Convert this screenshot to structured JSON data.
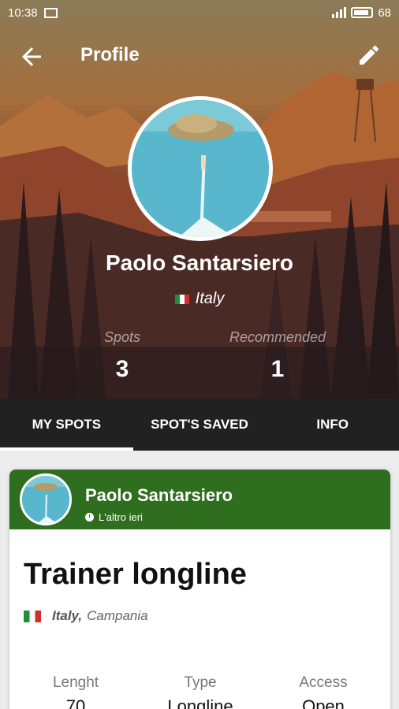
{
  "status_bar": {
    "time": "10:38",
    "battery": "68",
    "signal_icon": "signal-icon",
    "gallery_icon": "image-icon"
  },
  "app_bar": {
    "title": "Profile",
    "back_icon": "arrow-left-icon",
    "edit_icon": "pencil-icon"
  },
  "profile": {
    "name": "Paolo Santarsiero",
    "country": "Italy",
    "stats": [
      {
        "label": "Spots",
        "value": "3"
      },
      {
        "label": "Recommended",
        "value": "1"
      }
    ]
  },
  "tabs": [
    {
      "label": "MY SPOTS",
      "active": true
    },
    {
      "label": "SPOT'S SAVED",
      "active": false
    },
    {
      "label": "INFO",
      "active": false
    }
  ],
  "spot_card": {
    "author": "Paolo Santarsiero",
    "time": "L'altro ieri",
    "title": "Trainer longline",
    "country": "Italy,",
    "region": "Campania",
    "meta": [
      {
        "label": "Lenght",
        "value": "70"
      },
      {
        "label": "Type",
        "value": "Longline"
      },
      {
        "label": "Access",
        "value": "Open"
      }
    ]
  },
  "colors": {
    "card_header": "#2f6e1e",
    "tab_bar": "#212121"
  }
}
